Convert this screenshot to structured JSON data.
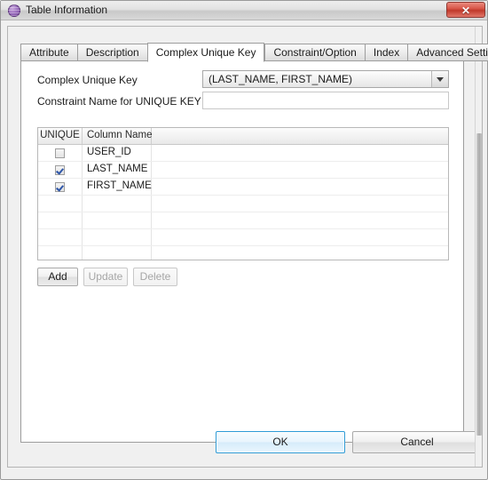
{
  "window": {
    "title": "Table Information",
    "icon": "purple-sphere-icon",
    "close_label": "✕"
  },
  "tabs": [
    {
      "label": "Attribute",
      "selected": false
    },
    {
      "label": "Description",
      "selected": false
    },
    {
      "label": "Complex Unique Key",
      "selected": true
    },
    {
      "label": "Constraint/Option",
      "selected": false
    },
    {
      "label": "Index",
      "selected": false
    },
    {
      "label": "Advanced Settings",
      "selected": false
    }
  ],
  "form": {
    "complex_unique_key_label": "Complex Unique Key",
    "complex_unique_key_value": "(LAST_NAME, FIRST_NAME)",
    "constraint_name_label": "Constraint Name for UNIQUE KEY",
    "constraint_name_value": "",
    "constraint_name_placeholder": ""
  },
  "grid": {
    "columns": [
      "UNIQUE",
      "Column Name",
      ""
    ],
    "rows": [
      {
        "unique": false,
        "column_name": "USER_ID"
      },
      {
        "unique": true,
        "column_name": "LAST_NAME"
      },
      {
        "unique": true,
        "column_name": "FIRST_NAME"
      },
      {
        "unique": null,
        "column_name": ""
      },
      {
        "unique": null,
        "column_name": ""
      },
      {
        "unique": null,
        "column_name": ""
      },
      {
        "unique": null,
        "column_name": ""
      }
    ]
  },
  "actions": {
    "add": "Add",
    "update": "Update",
    "delete": "Delete"
  },
  "dialog_buttons": {
    "ok": "OK",
    "cancel": "Cancel"
  },
  "colors": {
    "window_bg": "#f0f0f0",
    "tab_selected_bg": "#ffffff",
    "close_red": "#c0392b",
    "ok_focus_blue": "#2e9bd6",
    "checkmark_blue": "#2d55a8",
    "title_icon_purple": "#9b6fbe"
  }
}
